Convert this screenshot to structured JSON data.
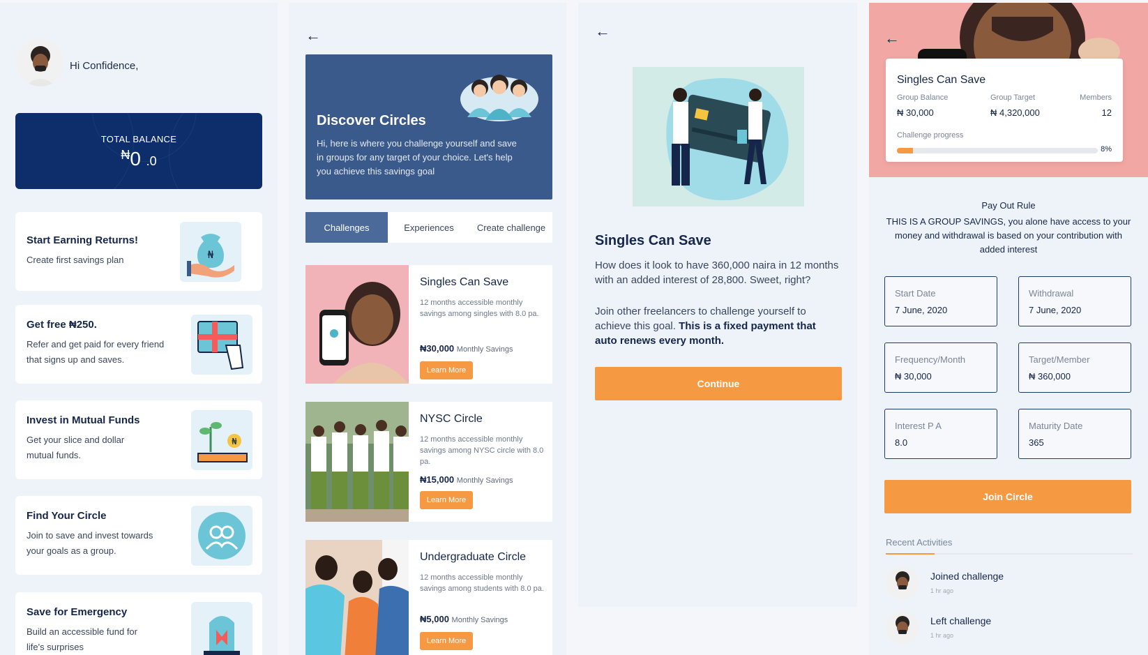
{
  "home": {
    "greeting": "Hi Confidence,",
    "balance_label": "TOTAL BALANCE",
    "balance_currency": "₦",
    "balance_amount": "0",
    "balance_decimal": ".0",
    "features": [
      {
        "title": "Start Earning Returns!",
        "desc": "Create first savings plan"
      },
      {
        "title": "Get free ₦250.",
        "desc": "Refer and get paid for every friend that signs up and saves."
      },
      {
        "title": "Invest in Mutual Funds",
        "desc": "Get your slice and dollar mutual funds."
      },
      {
        "title": "Find Your Circle",
        "desc": "Join to save and invest towards your goals as a group."
      },
      {
        "title": "Save for Emergency",
        "desc": "Build an accessible fund for life's surprises"
      }
    ]
  },
  "discover": {
    "back_icon": "arrow-left-icon",
    "title": "Discover Circles",
    "desc": "Hi, here is where you challenge yourself and save in groups for any target of your choice. Let's help you achieve this savings goal",
    "tabs": [
      "Challenges",
      "Experiences",
      "Create challenge"
    ],
    "active_tab": "Challenges",
    "circles": [
      {
        "name": "Singles Can Save",
        "desc": "12 months accessible monthly savings among singles with 8.0 pa.",
        "amount": "₦30,000",
        "amount_suffix": "Monthly Savings",
        "cta": "Learn More"
      },
      {
        "name": "NYSC Circle",
        "desc": "12 months accessible monthly savings among NYSC circle with 8.0 pa.",
        "amount": "₦15,000",
        "amount_suffix": "Monthly Savings",
        "cta": "Learn More"
      },
      {
        "name": "Undergraduate Circle",
        "desc": "12 months accessible monthly savings among students with 8.0 pa.",
        "amount": "₦5,000",
        "amount_suffix": "Monthly Savings",
        "cta": "Learn More"
      }
    ]
  },
  "detail": {
    "title": "Singles Can Save",
    "para1": "How does it look to have 360,000 naira in 12 months with an added interest of 28,800. Sweet, right?",
    "para2_plain": "Join other freelancers to challenge yourself to achieve this goal. ",
    "para2_bold": "This is a fixed payment that auto renews every month.",
    "continue_label": "Continue"
  },
  "circle": {
    "title": "Singles Can Save",
    "group_balance_label": "Group Balance",
    "group_balance": "₦ 30,000",
    "group_target_label": "Group Target",
    "group_target": "₦ 4,320,000",
    "members_label": "Members",
    "members": "12",
    "progress_label": "Challenge progress",
    "progress_text": "8%",
    "progress_value": 0.08,
    "payout_title": "Pay Out Rule",
    "payout_desc": "THIS IS A GROUP SAVINGS, you alone have access to your money and withdrawal is based on your contribution with added interest",
    "fields": [
      {
        "label": "Start Date",
        "value": "7 June, 2020"
      },
      {
        "label": "Withdrawal",
        "value": "7 June, 2020"
      },
      {
        "label": "Frequency/Month",
        "value": "₦ 30,000"
      },
      {
        "label": "Target/Member",
        "value": "₦ 360,000"
      },
      {
        "label": "Interest P A",
        "value": "8.0"
      },
      {
        "label": "Maturity Date",
        "value": "365"
      }
    ],
    "join_label": "Join Circle",
    "recent_label": "Recent Activities",
    "activities": [
      {
        "name": "Joined challenge",
        "time": "1 hr ago"
      },
      {
        "name": "Left challenge",
        "time": "1 hr ago"
      }
    ]
  },
  "colors": {
    "navy": "#0d2e6b",
    "accent": "#f59a43",
    "discover": "#3a5a8c"
  }
}
